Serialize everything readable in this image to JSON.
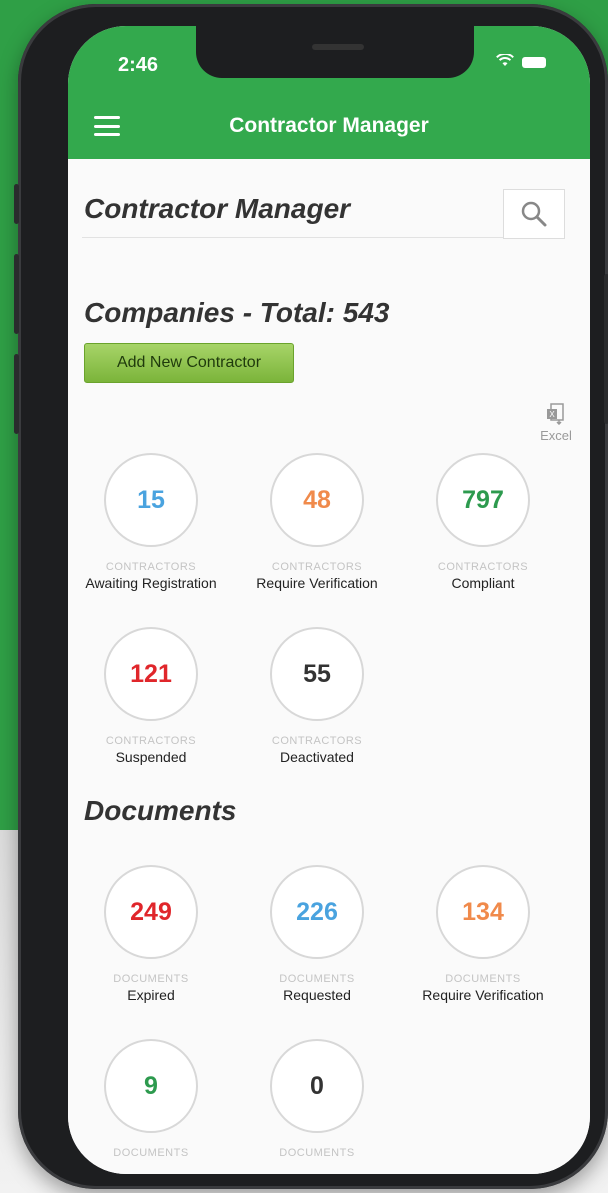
{
  "status_bar": {
    "time": "2:46"
  },
  "header": {
    "title": "Contractor Manager"
  },
  "app_title": "Contractor Manager",
  "companies": {
    "title": "Companies - Total: 543",
    "add_button": "Add New Contractor",
    "excel_label": "Excel",
    "stats": [
      {
        "value": "15",
        "kind": "CONTRACTORS",
        "label": "Awaiting Registration",
        "color": "#4aa3df"
      },
      {
        "value": "48",
        "kind": "CONTRACTORS",
        "label": "Require Verification",
        "color": "#f08a4b"
      },
      {
        "value": "797",
        "kind": "CONTRACTORS",
        "label": "Compliant",
        "color": "#2d9a4e"
      },
      {
        "value": "121",
        "kind": "CONTRACTORS",
        "label": "Suspended",
        "color": "#e0262b"
      },
      {
        "value": "55",
        "kind": "CONTRACTORS",
        "label": "Deactivated",
        "color": "#333333"
      }
    ]
  },
  "documents": {
    "title": "Documents",
    "stats": [
      {
        "value": "249",
        "kind": "DOCUMENTS",
        "label": "Expired",
        "color": "#e0262b"
      },
      {
        "value": "226",
        "kind": "DOCUMENTS",
        "label": "Requested",
        "color": "#4aa3df"
      },
      {
        "value": "134",
        "kind": "DOCUMENTS",
        "label": "Require Verification",
        "color": "#f08a4b"
      },
      {
        "value": "9",
        "kind": "DOCUMENTS",
        "label": "",
        "color": "#2d9a4e"
      },
      {
        "value": "0",
        "kind": "DOCUMENTS",
        "label": "",
        "color": "#333333"
      }
    ]
  }
}
